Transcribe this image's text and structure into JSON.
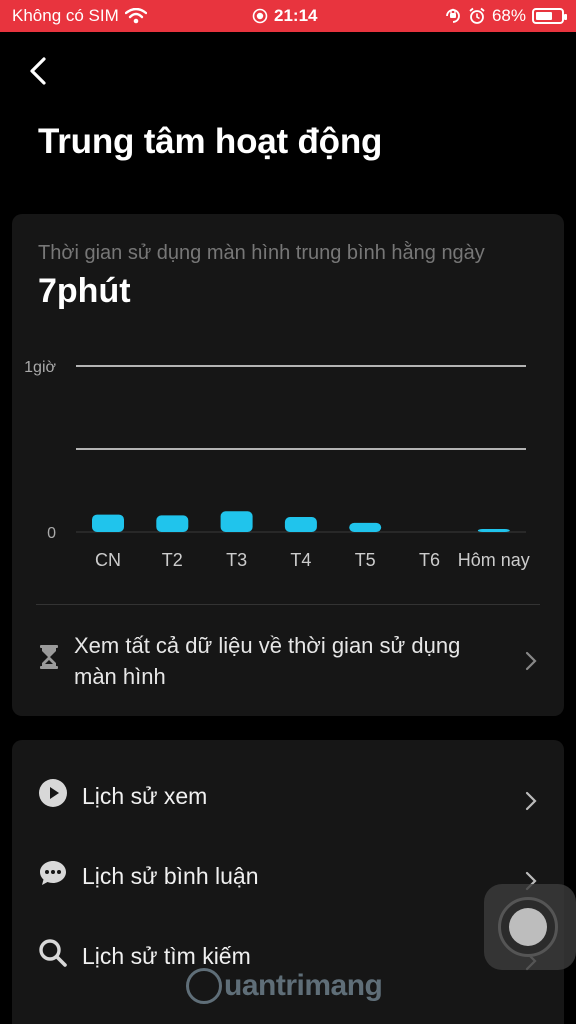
{
  "status_bar": {
    "carrier": "Không có SIM",
    "time": "21:14",
    "battery": "68%",
    "battery_level": 0.68,
    "icons": [
      "wifi-icon",
      "screen-record-icon",
      "orientation-lock-icon",
      "alarm-icon",
      "battery-icon"
    ]
  },
  "header": {
    "back_icon": "chevron-left-icon",
    "title": "Trung tâm hoạt động"
  },
  "screen_time": {
    "label": "Thời gian sử dụng màn hình trung bình hằng ngày",
    "value": "7phút"
  },
  "chart_data": {
    "type": "bar",
    "categories": [
      "CN",
      "T2",
      "T3",
      "T4",
      "T5",
      "T6",
      "Hôm nay"
    ],
    "values": [
      0.105,
      0.1,
      0.125,
      0.09,
      0.055,
      0,
      0.005
    ],
    "y_tick_labels": [
      "0",
      "1giờ"
    ],
    "ylim": [
      0,
      1
    ],
    "gridlines": [
      0,
      0.5,
      1
    ],
    "grid": true,
    "bar_color": "#20c4ec",
    "unit": "giờ"
  },
  "see_all": {
    "text": "Xem tất cả dữ liệu về thời gian sử dụng màn hình",
    "icon": "hourglass-icon"
  },
  "menu": [
    {
      "label": "Lịch sử xem",
      "icon": "play-icon"
    },
    {
      "label": "Lịch sử bình luận",
      "icon": "comment-icon"
    },
    {
      "label": "Lịch sử tìm kiếm",
      "icon": "search-icon"
    }
  ],
  "watermark": {
    "text": "uantrimang"
  },
  "colors": {
    "status_bar": "#e8343e",
    "background": "#000000",
    "card": "#161616",
    "accent": "#20c4ec"
  }
}
